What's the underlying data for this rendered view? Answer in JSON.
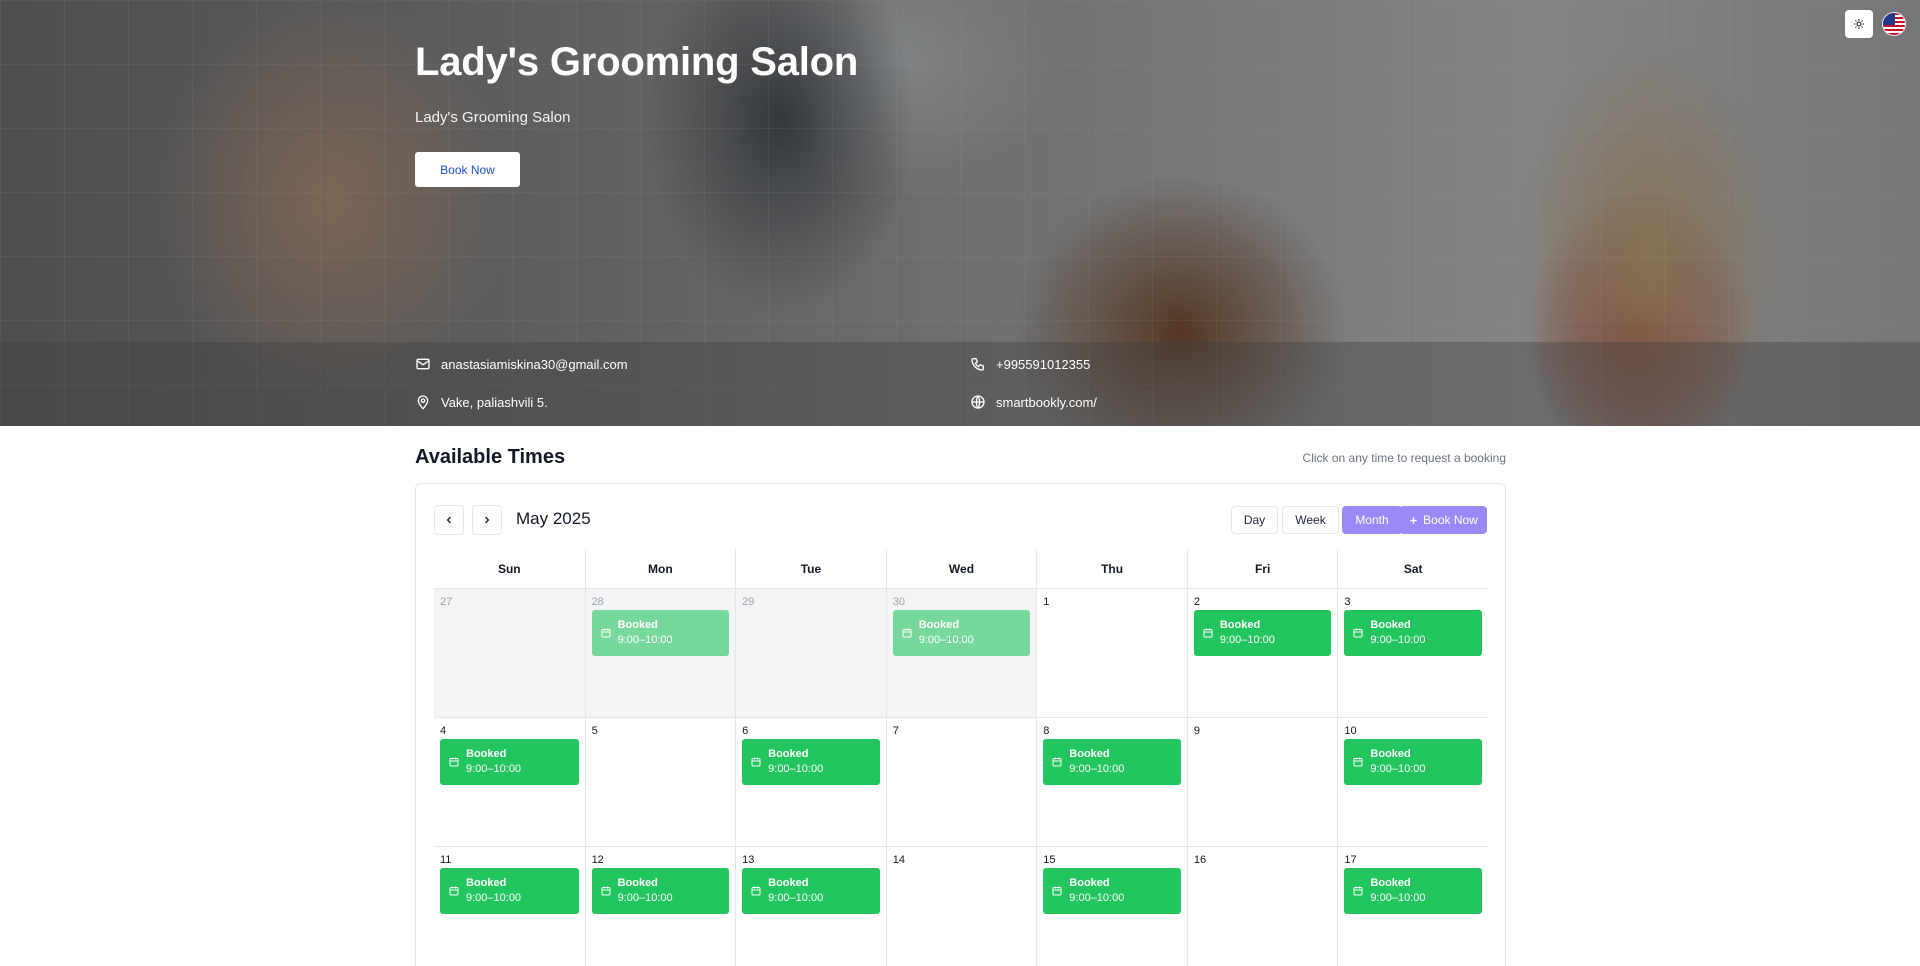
{
  "hero": {
    "title": "Lady's Grooming Salon",
    "subtitle": "Lady's Grooming Salon",
    "book_label": "Book Now"
  },
  "contact": {
    "email": "anastasiamiskina30@gmail.com",
    "phone": "+995591012355",
    "address": "Vake, paliashvili 5.",
    "website": "smartbookly.com/"
  },
  "section": {
    "title": "Available Times",
    "hint": "Click on any time to request a booking"
  },
  "calendar": {
    "month_label": "May 2025",
    "views": [
      "Day",
      "Week",
      "Month"
    ],
    "active_view": "Month",
    "add_label": "Book Now",
    "weekdays": [
      "Sun",
      "Mon",
      "Tue",
      "Wed",
      "Thu",
      "Fri",
      "Sat"
    ],
    "weeks": [
      [
        {
          "day": "27",
          "other": true,
          "event": null
        },
        {
          "day": "28",
          "other": true,
          "event": {
            "title": "Booked",
            "time": "9:00–10:00"
          }
        },
        {
          "day": "29",
          "other": true,
          "event": null
        },
        {
          "day": "30",
          "other": true,
          "event": {
            "title": "Booked",
            "time": "9:00–10:00"
          }
        },
        {
          "day": "1",
          "other": false,
          "event": null
        },
        {
          "day": "2",
          "other": false,
          "event": {
            "title": "Booked",
            "time": "9:00–10:00"
          }
        },
        {
          "day": "3",
          "other": false,
          "event": {
            "title": "Booked",
            "time": "9:00–10:00"
          }
        }
      ],
      [
        {
          "day": "4",
          "other": false,
          "event": {
            "title": "Booked",
            "time": "9:00–10:00"
          }
        },
        {
          "day": "5",
          "other": false,
          "event": null
        },
        {
          "day": "6",
          "other": false,
          "event": {
            "title": "Booked",
            "time": "9:00–10:00"
          }
        },
        {
          "day": "7",
          "other": false,
          "event": null
        },
        {
          "day": "8",
          "other": false,
          "event": {
            "title": "Booked",
            "time": "9:00–10:00"
          }
        },
        {
          "day": "9",
          "other": false,
          "event": null
        },
        {
          "day": "10",
          "other": false,
          "event": {
            "title": "Booked",
            "time": "9:00–10:00"
          }
        }
      ],
      [
        {
          "day": "11",
          "other": false,
          "event": {
            "title": "Booked",
            "time": "9:00–10:00"
          }
        },
        {
          "day": "12",
          "other": false,
          "event": {
            "title": "Booked",
            "time": "9:00–10:00"
          }
        },
        {
          "day": "13",
          "other": false,
          "event": {
            "title": "Booked",
            "time": "9:00–10:00"
          }
        },
        {
          "day": "14",
          "other": false,
          "event": null
        },
        {
          "day": "15",
          "other": false,
          "event": {
            "title": "Booked",
            "time": "9:00–10:00"
          }
        },
        {
          "day": "16",
          "other": false,
          "event": null
        },
        {
          "day": "17",
          "other": false,
          "event": {
            "title": "Booked",
            "time": "9:00–10:00"
          }
        }
      ]
    ]
  },
  "colors": {
    "accent": "#9b87f5",
    "booked": "#22c55e",
    "booked_past": "#77d89b",
    "link": "#1d4ed8"
  },
  "icons": {
    "theme": "sun-icon",
    "language": "us-flag-icon",
    "email": "mail-icon",
    "phone": "phone-icon",
    "address": "map-pin-icon",
    "website": "globe-icon",
    "prev": "chevron-left-icon",
    "next": "chevron-right-icon",
    "add": "plus-icon",
    "event": "calendar-icon"
  }
}
